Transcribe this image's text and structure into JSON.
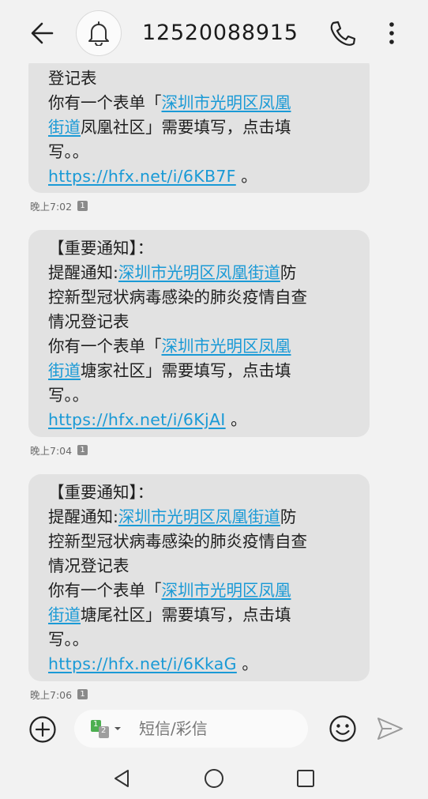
{
  "header": {
    "title": "12520088915",
    "back_icon": "arrow-left-icon",
    "avatar_icon": "bell-icon",
    "call_icon": "phone-icon",
    "more_icon": "more-vertical-icon"
  },
  "messages": [
    {
      "lines": [
        "登记表"
      ],
      "form_prefix": "你有一个表单「",
      "form_link_a": "深圳市光明区凤凰",
      "form_link_b": "街道",
      "form_suffix_b": "凤凰社区」需要填写，点击填",
      "form_tail": "写。。",
      "url": "https://hfx.net/i/6KB7F",
      "url_suffix": " 。",
      "time": "晚上7:02",
      "sim": "1"
    },
    {
      "heading": "【重要通知】：",
      "notice_prefix": "提醒通知:",
      "notice_link": "深圳市光明区凤凰街道",
      "notice_suffix": "防",
      "notice_line2": "控新型冠状病毒感染的肺炎疫情自查",
      "notice_line3": "情况登记表",
      "form_prefix": "你有一个表单「",
      "form_link_a": "深圳市光明区凤凰",
      "form_link_b": "街道",
      "form_suffix_b": "塘家社区」需要填写，点击填",
      "form_tail": "写。。",
      "url": "https://hfx.net/i/6KjAI",
      "url_suffix": " 。",
      "time": "晚上7:04",
      "sim": "1"
    },
    {
      "heading": "【重要通知】：",
      "notice_prefix": "提醒通知:",
      "notice_link": "深圳市光明区凤凰街道",
      "notice_suffix": "防",
      "notice_line2": "控新型冠状病毒感染的肺炎疫情自查",
      "notice_line3": "情况登记表",
      "form_prefix": "你有一个表单「",
      "form_link_a": "深圳市光明区凤凰",
      "form_link_b": "街道",
      "form_suffix_b": "塘尾社区」需要填写，点击填",
      "form_tail": "写。。",
      "url": "https://hfx.net/i/6KkaG",
      "url_suffix": " 。",
      "time": "晚上7:06",
      "sim": "1"
    }
  ],
  "composer": {
    "placeholder": "短信/彩信",
    "sim_selected": "1",
    "sim_other": "2",
    "add_icon": "plus-circle-icon",
    "emoji_icon": "smiley-icon",
    "send_icon": "send-icon"
  },
  "navbar": {
    "back_icon": "triangle-back-icon",
    "home_icon": "circle-home-icon",
    "recents_icon": "square-recents-icon"
  },
  "colors": {
    "background": "#f2f2f2",
    "bubble": "#e2e2e2",
    "link": "#1a9ad6",
    "sim_green": "#4caf50"
  }
}
